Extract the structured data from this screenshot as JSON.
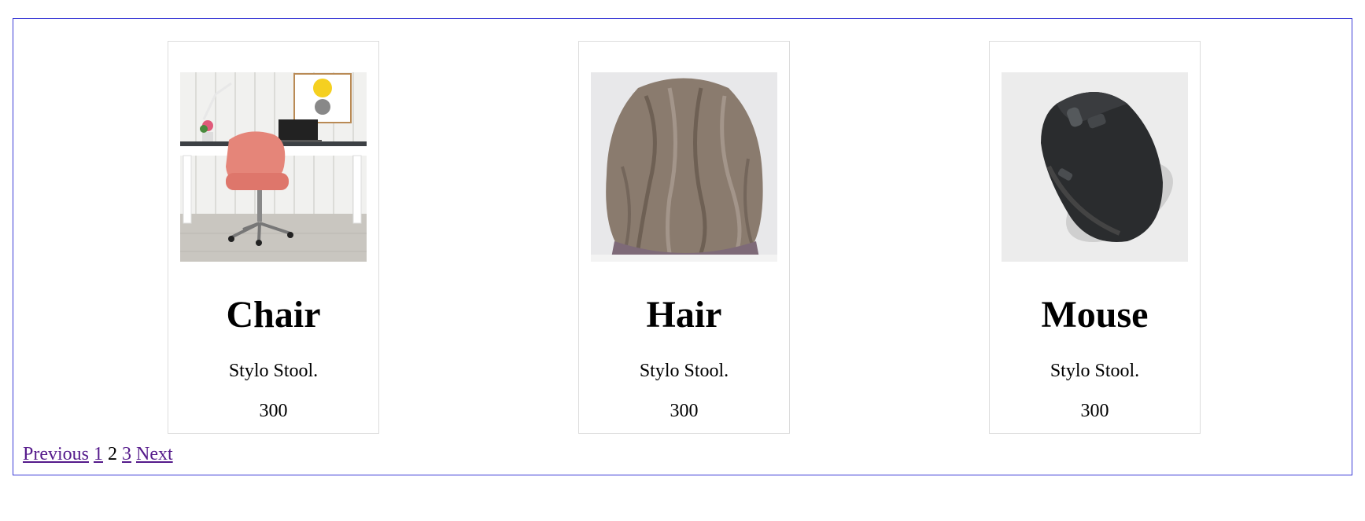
{
  "products": [
    {
      "title": "Chair",
      "description": "Stylo Stool.",
      "price": "300",
      "image_icon": "chair-photo"
    },
    {
      "title": "Hair",
      "description": "Stylo Stool.",
      "price": "300",
      "image_icon": "hair-photo"
    },
    {
      "title": "Mouse",
      "description": "Stylo Stool.",
      "price": "300",
      "image_icon": "mouse-photo"
    }
  ],
  "pagination": {
    "previous_label": "Previous",
    "page_1": "1",
    "page_2": "2",
    "page_3": "3",
    "next_label": "Next",
    "current_page": 2
  },
  "colors": {
    "frame_border": "#3b3bd6",
    "card_border": "#dcdcdc",
    "link_visited": "#551a8b"
  }
}
